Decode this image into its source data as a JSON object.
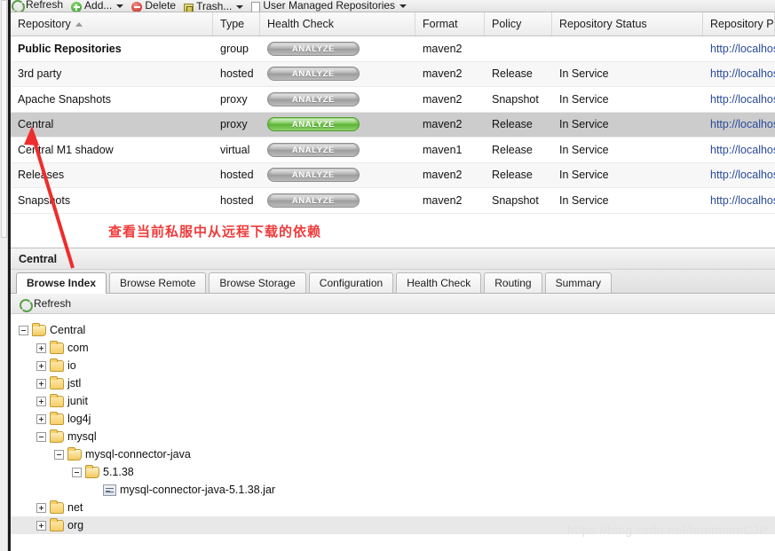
{
  "toolbar": {
    "items": [
      {
        "label": "Refresh",
        "icon": "refresh-icon",
        "caret": false
      },
      {
        "label": "Add...",
        "icon": "add-icon",
        "caret": true
      },
      {
        "label": "Delete",
        "icon": "delete-icon",
        "caret": false
      },
      {
        "label": "Trash...",
        "icon": "trash-icon",
        "caret": true
      },
      {
        "label": "User Managed Repositories",
        "icon": "page-icon",
        "caret": true
      }
    ]
  },
  "grid": {
    "columns": [
      {
        "label": "Repository",
        "sorted": true
      },
      {
        "label": "Type",
        "sorted": false
      },
      {
        "label": "Health Check",
        "sorted": false
      },
      {
        "label": "Format",
        "sorted": false
      },
      {
        "label": "Policy",
        "sorted": false
      },
      {
        "label": "Repository Status",
        "sorted": false
      },
      {
        "label": "Repository Pa",
        "sorted": false
      }
    ],
    "health_label": "ANALYZE",
    "rows": [
      {
        "name": "Public Repositories",
        "type": "group",
        "health": "ANALYZE",
        "health_state": "inactive",
        "format": "maven2",
        "policy": "",
        "status": "",
        "path": "http://localhos",
        "bold": true,
        "selected": false
      },
      {
        "name": "3rd party",
        "type": "hosted",
        "health": "ANALYZE",
        "health_state": "inactive",
        "format": "maven2",
        "policy": "Release",
        "status": "In Service",
        "path": "http://localhos",
        "bold": false,
        "selected": false
      },
      {
        "name": "Apache Snapshots",
        "type": "proxy",
        "health": "ANALYZE",
        "health_state": "inactive",
        "format": "maven2",
        "policy": "Snapshot",
        "status": "In Service",
        "path": "http://localhos",
        "bold": false,
        "selected": false
      },
      {
        "name": "Central",
        "type": "proxy",
        "health": "ANALYZE",
        "health_state": "active",
        "format": "maven2",
        "policy": "Release",
        "status": "In Service",
        "path": "http://localhos",
        "bold": false,
        "selected": true
      },
      {
        "name": "Central M1 shadow",
        "type": "virtual",
        "health": "ANALYZE",
        "health_state": "inactive",
        "format": "maven1",
        "policy": "Release",
        "status": "In Service",
        "path": "http://localhos",
        "bold": false,
        "selected": false
      },
      {
        "name": "Releases",
        "type": "hosted",
        "health": "ANALYZE",
        "health_state": "inactive",
        "format": "maven2",
        "policy": "Release",
        "status": "In Service",
        "path": "http://localhos",
        "bold": false,
        "selected": false
      },
      {
        "name": "Snapshots",
        "type": "hosted",
        "health": "ANALYZE",
        "health_state": "inactive",
        "format": "maven2",
        "policy": "Snapshot",
        "status": "In Service",
        "path": "http://localhos",
        "bold": false,
        "selected": false
      }
    ]
  },
  "annotation": {
    "text": "查看当前私服中从远程下载的依赖",
    "color": "#ef3b3b"
  },
  "detail": {
    "title": "Central",
    "tabs": [
      {
        "label": "Browse Index",
        "active": true
      },
      {
        "label": "Browse Remote",
        "active": false
      },
      {
        "label": "Browse Storage",
        "active": false
      },
      {
        "label": "Configuration",
        "active": false
      },
      {
        "label": "Health Check",
        "active": false
      },
      {
        "label": "Routing",
        "active": false
      },
      {
        "label": "Summary",
        "active": false
      }
    ],
    "refresh_label": "Refresh",
    "tree": [
      {
        "label": "Central",
        "depth": 0,
        "icon": "folder-open-icon",
        "toggle": "minus",
        "highlight": false
      },
      {
        "label": "com",
        "depth": 1,
        "icon": "folder-icon",
        "toggle": "plus",
        "highlight": false
      },
      {
        "label": "io",
        "depth": 1,
        "icon": "folder-icon",
        "toggle": "plus",
        "highlight": false
      },
      {
        "label": "jstl",
        "depth": 1,
        "icon": "folder-icon",
        "toggle": "plus",
        "highlight": false
      },
      {
        "label": "junit",
        "depth": 1,
        "icon": "folder-icon",
        "toggle": "plus",
        "highlight": false
      },
      {
        "label": "log4j",
        "depth": 1,
        "icon": "folder-icon",
        "toggle": "plus",
        "highlight": false
      },
      {
        "label": "mysql",
        "depth": 1,
        "icon": "folder-open-icon",
        "toggle": "minus",
        "highlight": false
      },
      {
        "label": "mysql-connector-java",
        "depth": 2,
        "icon": "folder-open-icon",
        "toggle": "minus",
        "highlight": false
      },
      {
        "label": "5.1.38",
        "depth": 3,
        "icon": "folder-open-icon",
        "toggle": "minus",
        "highlight": false
      },
      {
        "label": "mysql-connector-java-5.1.38.jar",
        "depth": 4,
        "icon": "jar-icon",
        "toggle": "none",
        "highlight": false
      },
      {
        "label": "net",
        "depth": 1,
        "icon": "folder-icon",
        "toggle": "plus",
        "highlight": false
      },
      {
        "label": "org",
        "depth": 1,
        "icon": "folder-icon",
        "toggle": "plus",
        "highlight": true
      }
    ]
  },
  "watermark": {
    "text": "https://blog.csdn.net/mmmmmCJP"
  }
}
